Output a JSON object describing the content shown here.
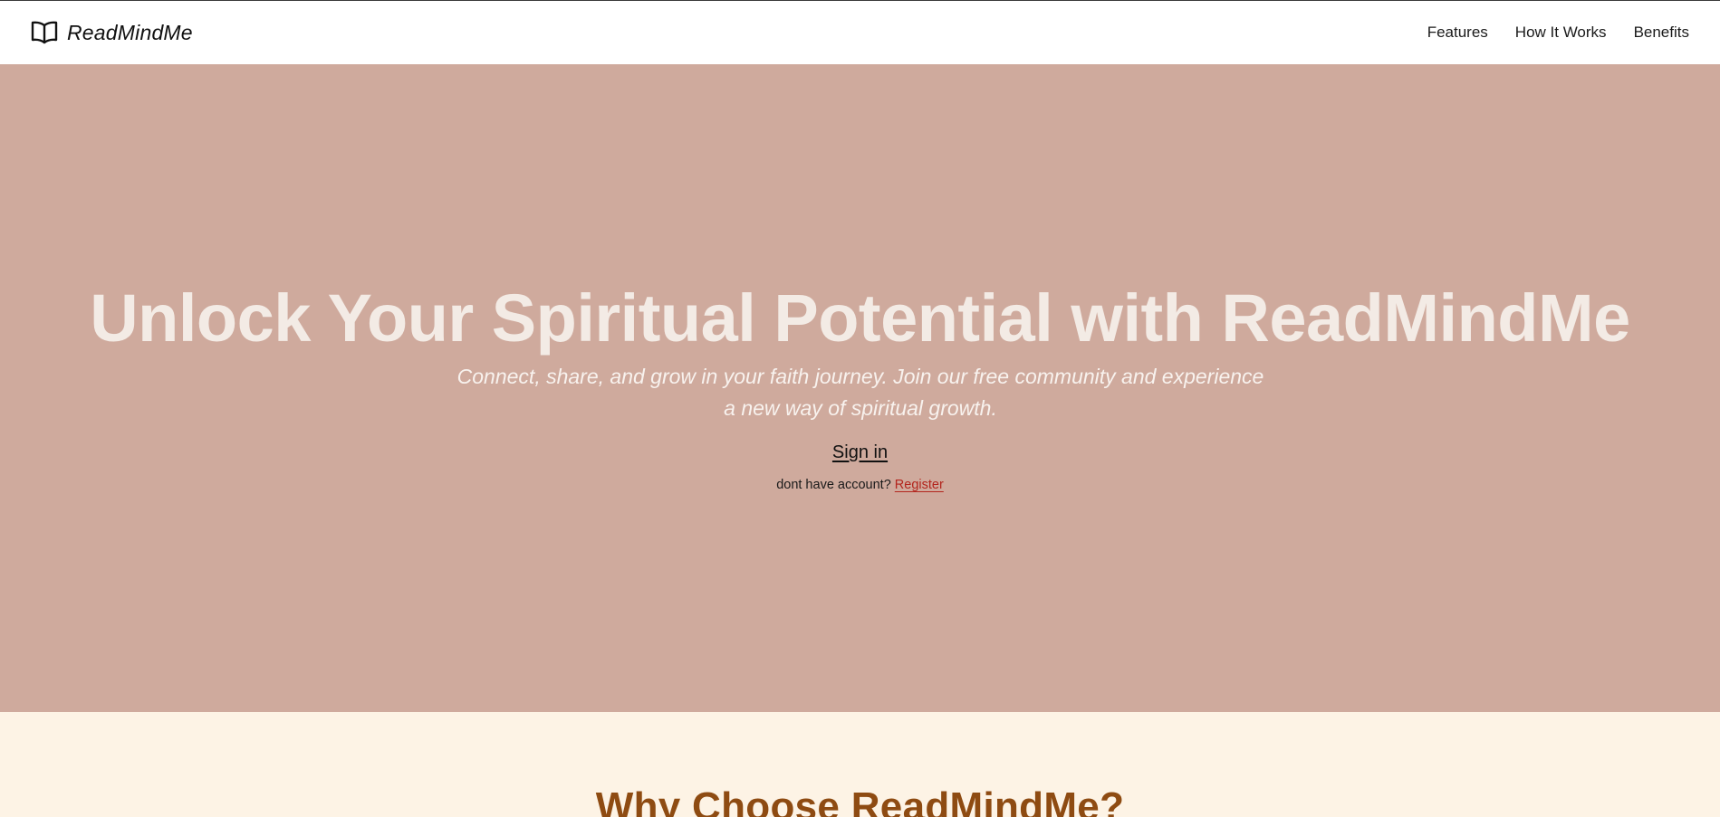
{
  "app": {
    "brand_name": "ReadMindMe",
    "brand_icon": "open-book-icon"
  },
  "nav": {
    "items": [
      {
        "label": "Features"
      },
      {
        "label": "How It Works"
      },
      {
        "label": "Benefits"
      }
    ]
  },
  "hero": {
    "title": "Unlock Your Spiritual Potential with ReadMindMe",
    "subtitle": "Connect, share, and grow in your faith journey. Join our free community and experience a new way of spiritual growth.",
    "signin_label": "Sign in",
    "account_prompt": "dont have account?",
    "register_label": "Register"
  },
  "why": {
    "title": "Why Choose ReadMindMe?"
  },
  "colors": {
    "hero_bg": "#cfaa9d",
    "page_bg": "#fdf3e5",
    "accent_heading": "#8e4b12",
    "register_link": "#b3261e"
  }
}
